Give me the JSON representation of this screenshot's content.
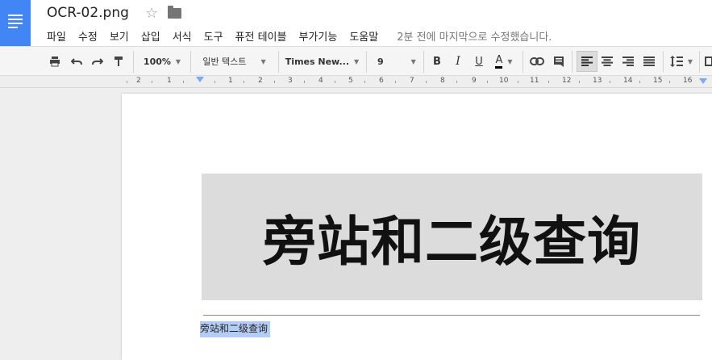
{
  "header": {
    "doc_title": "OCR-02.png",
    "star_glyph": "☆",
    "menu": [
      "파일",
      "수정",
      "보기",
      "삽입",
      "서식",
      "도구",
      "퓨전 테이블",
      "부가기능",
      "도움말"
    ],
    "last_saved": "2분 전에 마지막으로 수정했습니다."
  },
  "toolbar": {
    "zoom": "100%",
    "style": "일반 텍스트",
    "font": "Times New...",
    "font_size": "9",
    "bold": "B",
    "italic": "I",
    "underline": "U",
    "text_color": "A",
    "icons": [
      "print-icon",
      "undo-icon",
      "redo-icon",
      "paint-format-icon",
      "link-icon",
      "comment-icon",
      "align-left-icon",
      "align-center-icon",
      "align-right-icon",
      "justify-icon",
      "line-spacing-icon"
    ]
  },
  "ruler": {
    "labels": [
      "2",
      "1",
      "1",
      "2",
      "3",
      "4",
      "5",
      "6",
      "7",
      "8",
      "9",
      "10",
      "11",
      "12",
      "13",
      "14",
      "15",
      "16"
    ]
  },
  "document": {
    "image_text": "旁站和二级查询",
    "ocr_text": "旁站和二级查询"
  },
  "colors": {
    "brand": "#4285f4",
    "selection": "#b3cdf5"
  }
}
